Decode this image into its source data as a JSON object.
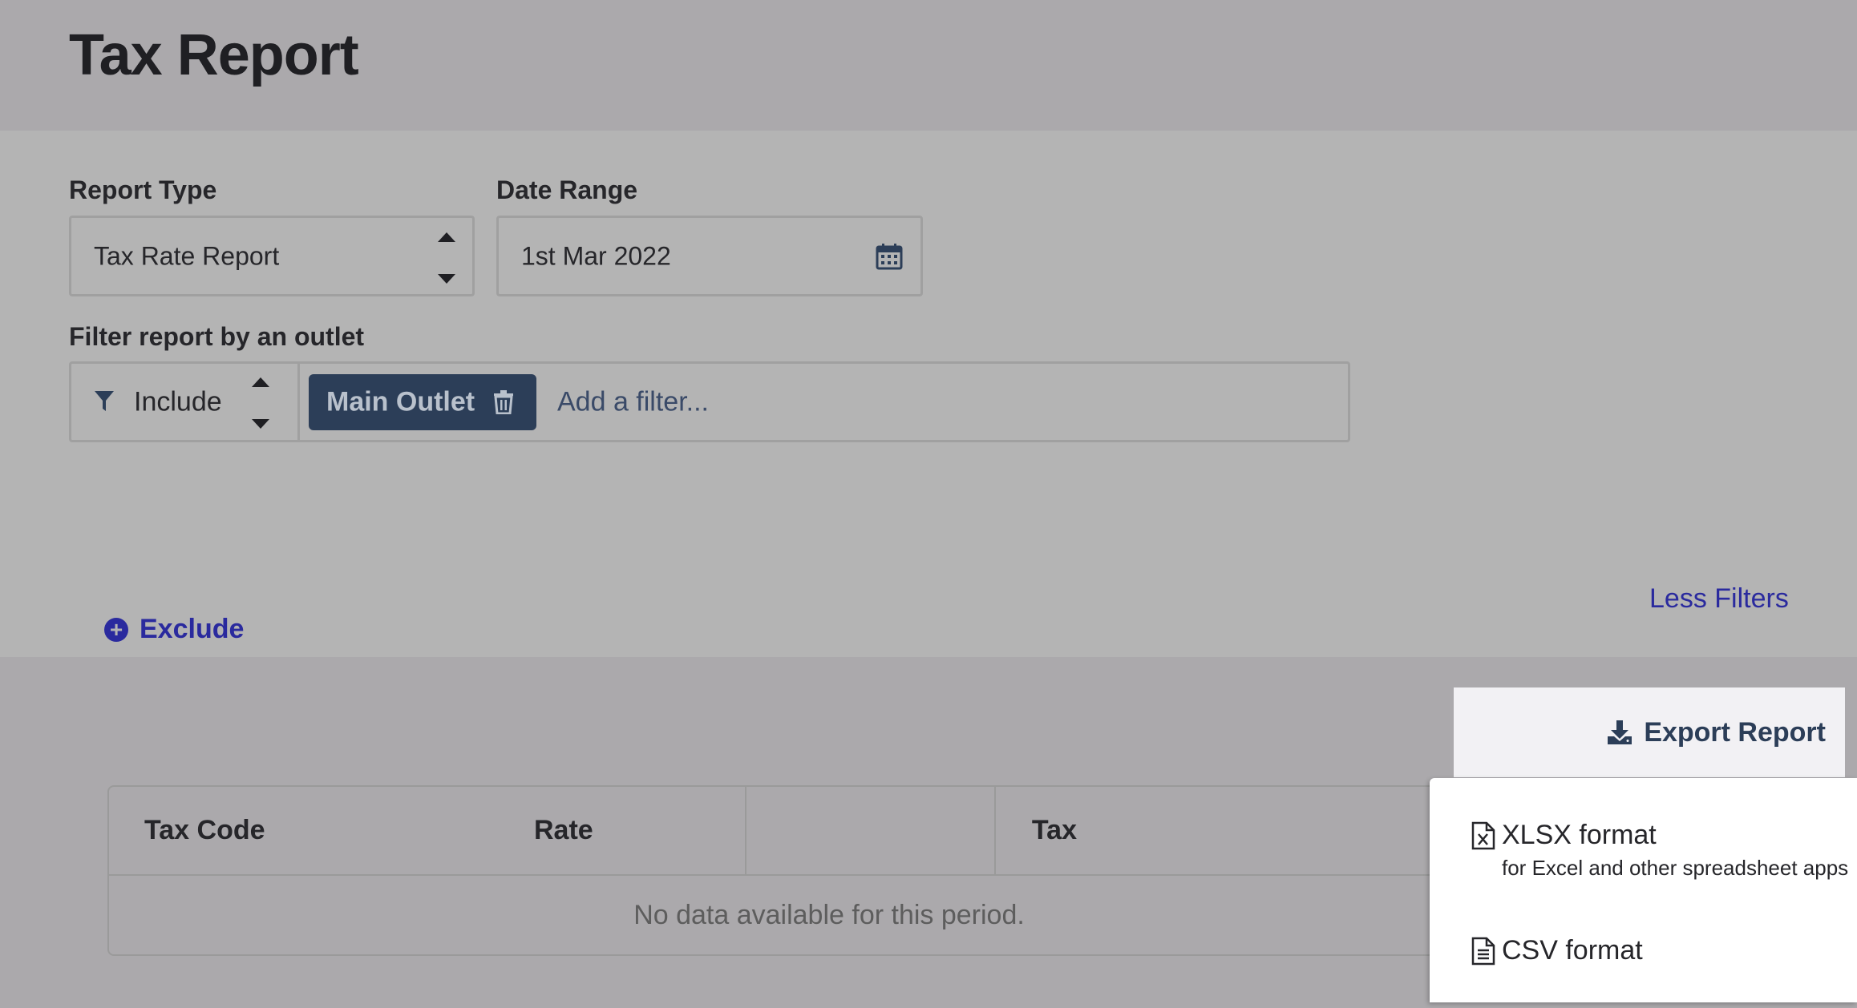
{
  "page": {
    "title": "Tax Report"
  },
  "filters": {
    "report_type": {
      "label": "Report Type",
      "value": "Tax Rate Report"
    },
    "date_range": {
      "label": "Date Range",
      "value": "1st Mar 2022",
      "icon": "calendar-icon"
    },
    "outlet": {
      "label": "Filter report by an outlet",
      "mode": "Include",
      "mode_icon": "filter-icon",
      "chips": [
        {
          "label": "Main Outlet",
          "icon": "trash-icon"
        }
      ],
      "placeholder": "Add a filter..."
    },
    "exclude_label": "Exclude",
    "less_filters_label": "Less Filters"
  },
  "export": {
    "button_label": "Export Report",
    "icon": "download-icon",
    "menu": [
      {
        "label": "XLSX format",
        "sublabel": "for Excel and other spreadsheet apps",
        "icon": "xlsx-file-icon"
      },
      {
        "label": "CSV format",
        "icon": "csv-file-icon"
      }
    ]
  },
  "table": {
    "columns": [
      "Tax Code",
      "Rate",
      "Tax"
    ],
    "empty_message": "No data available for this period."
  },
  "colors": {
    "link": "#2a2a9e",
    "chip_bg": "#2c3e58",
    "header_bg": "#aba9ac",
    "filters_bg": "#b4b4b4"
  }
}
